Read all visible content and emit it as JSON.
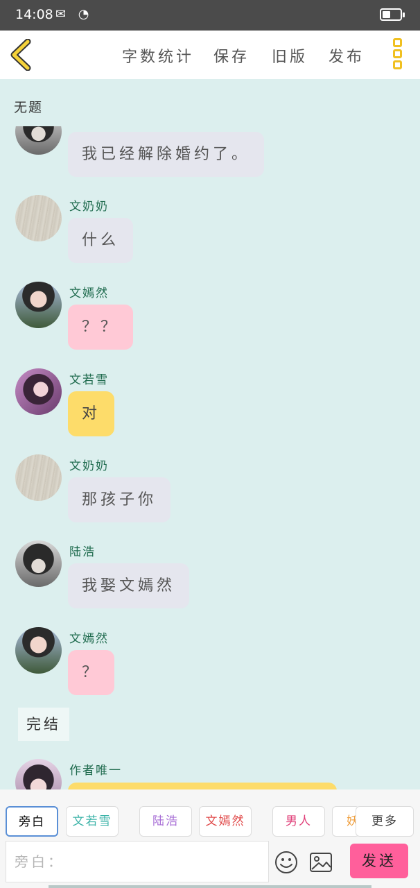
{
  "status": {
    "time": "14:08",
    "battery_level": 0.45
  },
  "topbar": {
    "actions": [
      "字数统计",
      "保存",
      "旧版",
      "发布"
    ],
    "back_icon": "chevron-left-icon",
    "more_icon": "vertical-dots-icon",
    "accent": "#f0c020"
  },
  "document": {
    "title": "无题"
  },
  "messages": [
    {
      "name": "",
      "text": "我已经解除婚约了。",
      "style": "grey",
      "avatar": "boy"
    },
    {
      "name": "文奶奶",
      "text": "什么",
      "style": "grey",
      "avatar": "wood"
    },
    {
      "name": "文嫣然",
      "text": "？？",
      "style": "pink",
      "avatar": "girl1"
    },
    {
      "name": "文若雪",
      "text": "对",
      "style": "yellow",
      "avatar": "girl2"
    },
    {
      "name": "文奶奶",
      "text": "那孩子你",
      "style": "grey",
      "avatar": "wood"
    },
    {
      "name": "陆浩",
      "text": "我娶文嫣然",
      "style": "grey",
      "avatar": "boy"
    },
    {
      "name": "文嫣然",
      "text": "？",
      "style": "pink",
      "avatar": "girl1"
    },
    {
      "name": "作者唯一",
      "text": "",
      "style": "yellow",
      "avatar": "author"
    }
  ],
  "end_tag": "完结",
  "roles": [
    {
      "label": "旁白",
      "color": "#444444",
      "active": true
    },
    {
      "label": "文若雪",
      "color": "#3bb3a8"
    },
    {
      "label": "陆浩",
      "color": "#a86fd6"
    },
    {
      "label": "文嫣然",
      "color": "#e04a4a"
    },
    {
      "label": "男人",
      "color": "#e0407a"
    },
    {
      "label": "妖",
      "color": "#f0a040"
    }
  ],
  "more_label": "更多",
  "input": {
    "placeholder": "旁白："
  },
  "send_label": "发送",
  "colors": {
    "send": "#ff5f9b",
    "background": "#dcefee",
    "name": "#1f6b4e"
  }
}
